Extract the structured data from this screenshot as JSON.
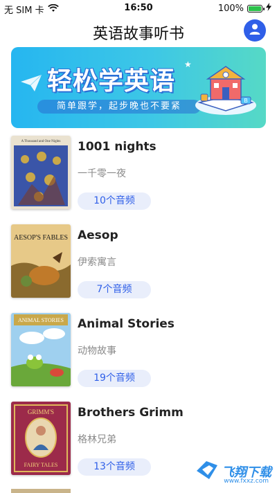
{
  "status_bar": {
    "carrier": "无 SIM 卡",
    "time": "16:50",
    "battery": "100%"
  },
  "nav": {
    "title": "英语故事听书",
    "profile_icon": "user-icon"
  },
  "banner": {
    "title": "轻松学英语",
    "subtitle": "简单跟学，起步晚也不要紧"
  },
  "books": [
    {
      "title": "1001 nights",
      "subtitle": "一千零一夜",
      "count": "10个音频",
      "cover_header": "A Thousand and One Nights",
      "cover_color": "#3a55a8"
    },
    {
      "title": "Aesop",
      "subtitle": "伊索寓言",
      "count": "7个音频",
      "cover_header": "AESOP'S FABLES",
      "cover_color": "#d8a84a"
    },
    {
      "title": "Animal Stories",
      "subtitle": "动物故事",
      "count": "19个音频",
      "cover_header": "ANIMAL STORIES",
      "cover_color": "#7ec0e6"
    },
    {
      "title": "Brothers Grimm",
      "subtitle": "格林兄弟",
      "count": "13个音频",
      "cover_header": "GRIMM'S",
      "cover_footer": "FAIRY TALES",
      "cover_color": "#9c2a4a"
    }
  ],
  "watermark": {
    "text": "飞翔下载",
    "url": "www.fxxz.com"
  },
  "colors": {
    "accent": "#2f5fe8",
    "count_bg": "#e9eefb"
  }
}
